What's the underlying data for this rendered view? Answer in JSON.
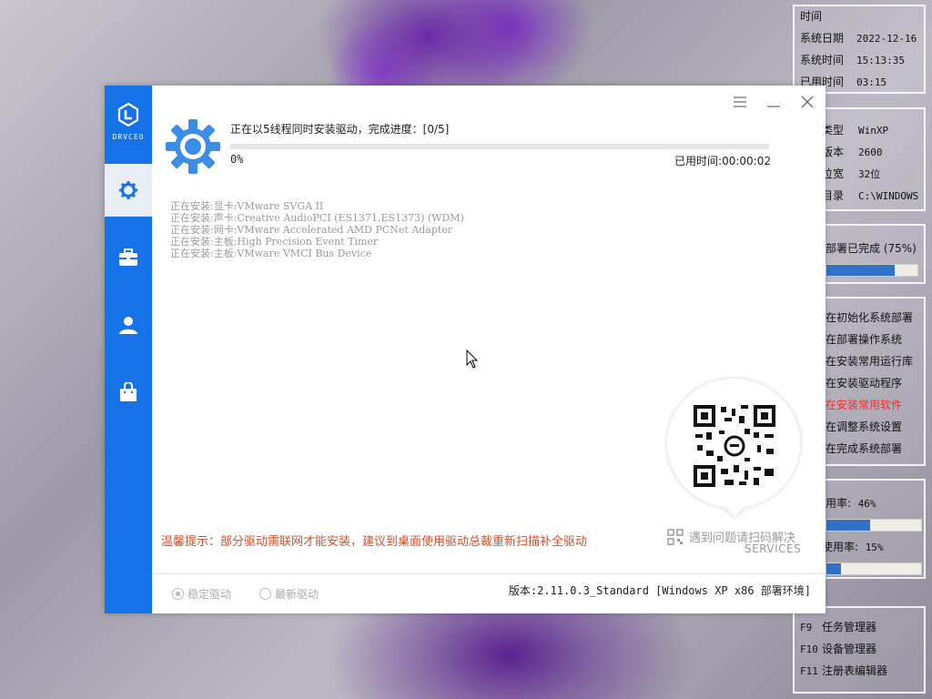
{
  "time_panel": {
    "title": "时间",
    "rows": [
      {
        "label": "系统日期",
        "value": "2022-12-16"
      },
      {
        "label": "系统时间",
        "value": "15:13:35"
      },
      {
        "label": "已用时间",
        "value": "03:15"
      }
    ]
  },
  "sys_panel": {
    "rows": [
      {
        "label": "类型",
        "value": "WinXP"
      },
      {
        "label": "版本",
        "value": "2600"
      },
      {
        "label": "位宽",
        "value": "32位"
      },
      {
        "label": "目录",
        "value": "C:\\WINDOWS"
      }
    ]
  },
  "deploy_panel": {
    "label": "部署已完成 (75%)",
    "progress": 0.75
  },
  "steps_panel": {
    "items": [
      {
        "label": "在初始化系统部署",
        "active": false
      },
      {
        "label": "在部署操作系统",
        "active": false
      },
      {
        "label": "在安装常用运行库",
        "active": false
      },
      {
        "label": "在安装驱动程序",
        "active": false
      },
      {
        "label": "在安装常用软件",
        "active": true
      },
      {
        "label": "在调整系统设置",
        "active": false
      },
      {
        "label": "在完成系统部署",
        "active": false
      }
    ]
  },
  "usage_panel": {
    "cpu": {
      "label": "用率:",
      "value": "46%",
      "fraction": 0.46
    },
    "mem": {
      "label": "使用率:",
      "value": "15%",
      "fraction": 0.15
    }
  },
  "hotkeys": [
    {
      "key": "F9",
      "label": "任务管理器"
    },
    {
      "key": "F10",
      "label": "设备管理器"
    },
    {
      "key": "F11",
      "label": "注册表编辑器"
    }
  ],
  "app": {
    "logo_text": "DRVCEO",
    "status_text": "正在以5线程同时安装驱动，完成进度：[0/5]",
    "progress_percent": "0%",
    "progress_value": 0,
    "elapsed": "已用时间:00:00:02",
    "log": [
      "正在安装:显卡:VMware SVGA II",
      "正在安装:声卡:Creative AudioPCI (ES1371,ES1373) (WDM)",
      "正在安装:网卡:VMware Accelerated AMD PCNet Adapter",
      "正在安装:主板:High Precision Event Timer",
      "正在安装:主板:VMware VMCI Bus Device"
    ],
    "tip": "温馨提示：部分驱动需联网才能安装，建议到桌面使用驱动总裁重新扫描补全驱动",
    "services_line1": "遇到问题请扫码解决",
    "services_line2": "SERVICES",
    "radio_stable": "稳定驱动",
    "radio_latest": "最新驱动",
    "version": "版本:2.11.0.3_Standard [Windows XP x86 部署环境]"
  },
  "colors": {
    "accent": "#1672e8",
    "tip": "#d9502a",
    "active_step": "#ff2a2a"
  }
}
